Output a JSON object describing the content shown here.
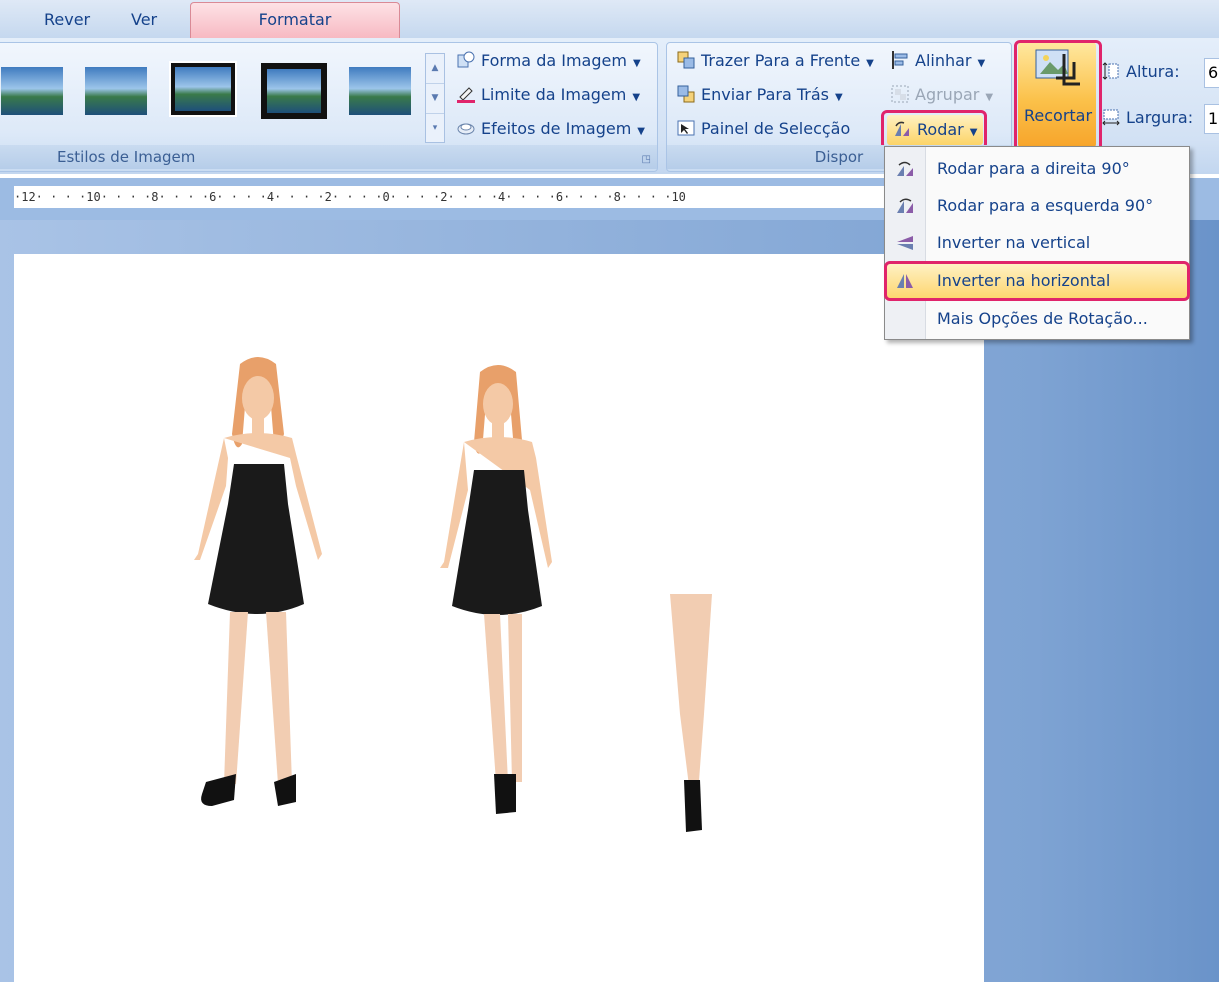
{
  "tabs": [
    "Rever",
    "Ver",
    "Formatar"
  ],
  "ribbon": {
    "styles_group": {
      "label": "Estilos de Imagem"
    },
    "image_cmds": {
      "shape": "Forma da Imagem",
      "border": "Limite da Imagem",
      "effects": "Efeitos de Imagem"
    },
    "arrange_group": {
      "label": "Dispor",
      "bring_front": "Trazer Para a Frente",
      "send_back": "Enviar Para Trás",
      "selection_pane": "Painel de Selecção",
      "align": "Alinhar",
      "group": "Agrupar",
      "rotate": "Rodar"
    },
    "crop": "Recortar",
    "size": {
      "height_label": "Altura:",
      "height_value": "6,",
      "width_label": "Largura:",
      "width_value": "1,"
    }
  },
  "ruler_text": "·12· · · ·10· · · ·8· · · ·6· · · ·4· · · ·2· · · ·0· · · ·2· · · ·4· · · ·6· · · ·8· · · ·10",
  "rotate_menu": [
    "Rodar para a direita 90°",
    "Rodar para a esquerda 90°",
    "Inverter na vertical",
    "Inverter na horizontal",
    "Mais Opções de Rotação..."
  ],
  "colors": {
    "highlight": "#e0246b",
    "accent": "#15428b"
  }
}
